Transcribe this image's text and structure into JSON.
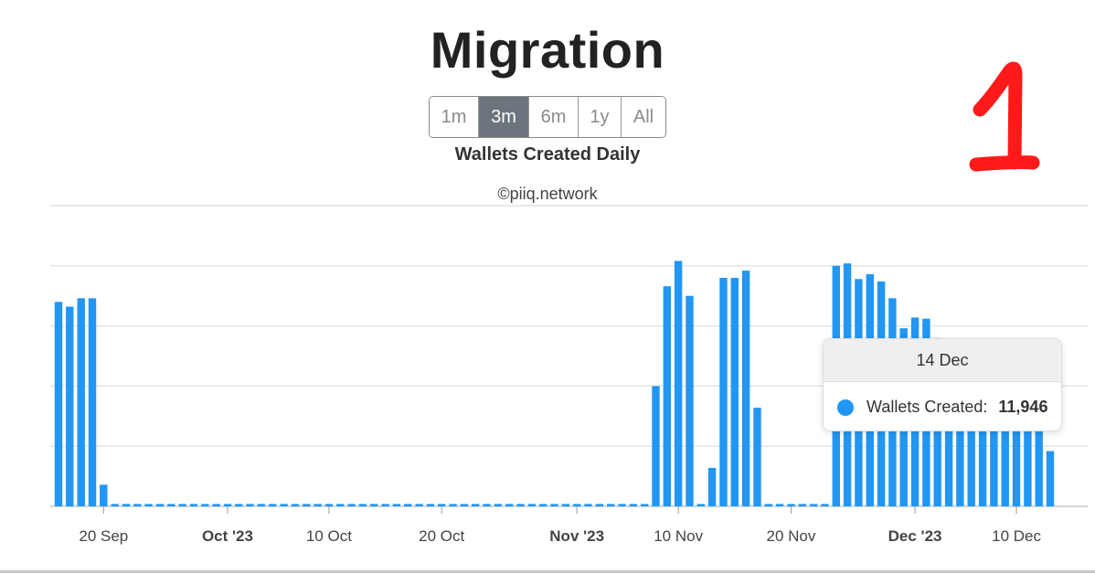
{
  "title": "Migration",
  "range_selector": [
    {
      "label": "1m",
      "active": false
    },
    {
      "label": "3m",
      "active": true
    },
    {
      "label": "6m",
      "active": false
    },
    {
      "label": "1y",
      "active": false
    },
    {
      "label": "All",
      "active": false
    }
  ],
  "subtitle": "Wallets Created Daily",
  "credit": "©piiq.network",
  "annotation": "1",
  "colors": {
    "bar": "#2196f3",
    "grid": "#e4e4e4",
    "annotation": "#ff1a1a",
    "active_button": "#6c757d"
  },
  "tooltip": {
    "date": "14 Dec",
    "series_label": "Wallets Created:",
    "value": "11,946"
  },
  "chart_data": {
    "type": "bar",
    "title": "Wallets Created Daily",
    "xlabel": "",
    "ylabel": "",
    "x_range": [
      "2023-09-16",
      "2023-12-17"
    ],
    "ylim": [
      0,
      25000
    ],
    "grid": true,
    "x_ticks": [
      {
        "label": "20 Sep",
        "date": "2023-09-20",
        "bold": false
      },
      {
        "label": "Oct '23",
        "date": "2023-10-01",
        "bold": true
      },
      {
        "label": "10 Oct",
        "date": "2023-10-10",
        "bold": false
      },
      {
        "label": "20 Oct",
        "date": "2023-10-20",
        "bold": false
      },
      {
        "label": "Nov '23",
        "date": "2023-11-01",
        "bold": true
      },
      {
        "label": "10 Nov",
        "date": "2023-11-10",
        "bold": false
      },
      {
        "label": "20 Nov",
        "date": "2023-11-20",
        "bold": false
      },
      {
        "label": "Dec '23",
        "date": "2023-12-01",
        "bold": true
      },
      {
        "label": "10 Dec",
        "date": "2023-12-10",
        "bold": false
      }
    ],
    "series": [
      {
        "start_date": "2023-09-16",
        "values": [
          17000,
          16600,
          17300,
          17300,
          1800,
          200,
          200,
          200,
          200,
          200,
          200,
          200,
          200,
          200,
          200,
          200,
          200,
          200,
          200,
          200,
          200,
          200,
          200,
          200,
          200,
          200,
          200,
          200,
          200,
          200,
          200,
          200,
          200,
          200,
          200,
          200,
          200,
          200,
          200,
          200,
          200,
          200,
          200,
          200,
          200,
          200,
          200,
          200,
          200,
          200,
          200,
          200,
          200,
          10000,
          18300,
          20400,
          17500,
          200,
          3200,
          19000,
          19000,
          19600,
          8200,
          200,
          200,
          200,
          200,
          200,
          200,
          20000,
          20200,
          18900,
          19300,
          18700,
          17300,
          14800,
          15700,
          15600,
          14000,
          13000,
          12500,
          12200,
          12000,
          11946,
          12000,
          12100,
          12500,
          10000,
          4600
        ]
      }
    ]
  }
}
